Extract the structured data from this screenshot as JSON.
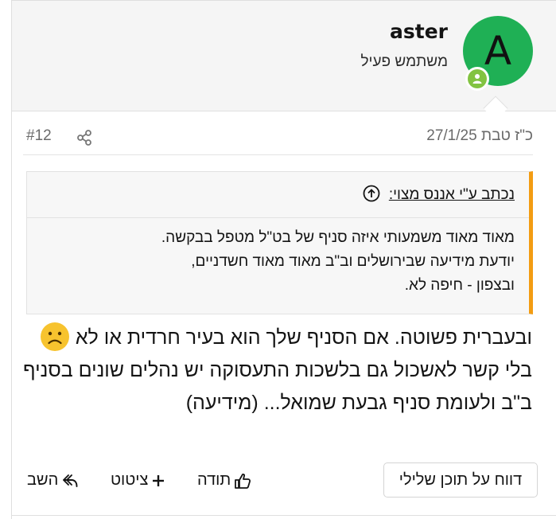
{
  "user": {
    "avatar_letter": "A",
    "username": "aster",
    "title": "משתמש פעיל",
    "avatar_color": "#1fb055",
    "online_badge_color": "#82c341"
  },
  "meta": {
    "date": "כ\"ז טבת 27/1/25",
    "post_number": "#12",
    "share_icon": "share-icon"
  },
  "quote": {
    "attribution": "נכתב ע\"י אננס מצוי:",
    "lines": [
      "מאוד מאוד משמעותי איזה סניף של בט\"ל מטפל בבקשה.",
      "יודעת מידיעה שבירושלים וב\"ב מאוד מאוד חשדניים,",
      "ובצפון - חיפה לא."
    ],
    "accent_color": "#f39c12"
  },
  "message": {
    "paragraph1": "ובעברית פשוטה. אם הסניף שלך הוא בעיר חרדית או לא",
    "emoji": "frowning-face",
    "paragraph2": "בלי קשר לאשכול גם בלשכות התעסוקה יש נהלים שונים בסניף ב\"ב ולעומת סניף גבעת שמואל... (מידיעה)"
  },
  "actions": {
    "report": "דווח על תוכן שלילי",
    "like": "תודה",
    "quote": "ציטוט",
    "reply": "השב"
  }
}
